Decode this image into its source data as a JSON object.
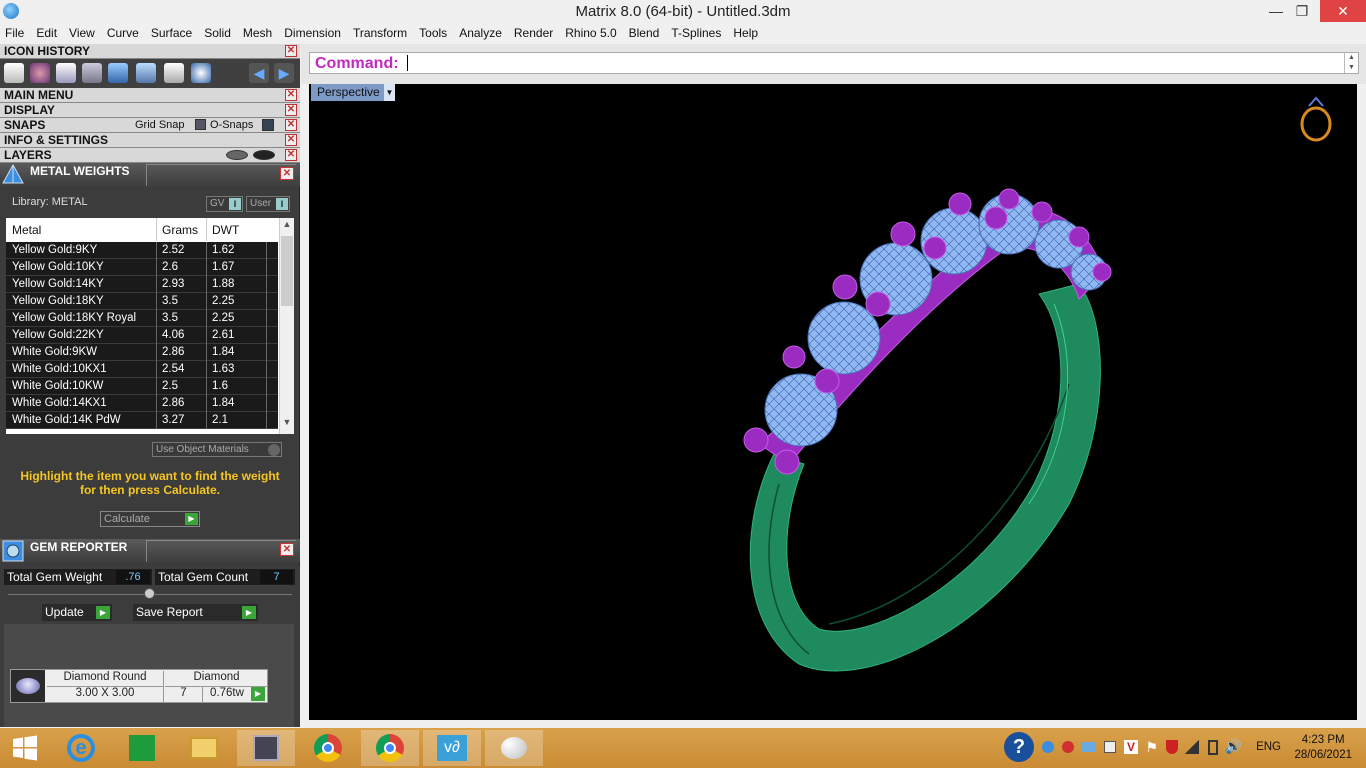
{
  "window": {
    "title": "Matrix 8.0 (64-bit) - Untitled.3dm",
    "min": "—",
    "max": "❐",
    "close": "✕"
  },
  "menu": [
    "File",
    "Edit",
    "View",
    "Curve",
    "Surface",
    "Solid",
    "Mesh",
    "Dimension",
    "Transform",
    "Tools",
    "Analyze",
    "Render",
    "Rhino 5.0",
    "Blend",
    "T-Splines",
    "Help"
  ],
  "panels": {
    "icon_history": "ICON HISTORY",
    "main_menu": "MAIN MENU",
    "display": "DISPLAY",
    "snaps": "SNAPS",
    "grid_snap": "Grid Snap",
    "o_snaps": "O-Snaps",
    "info_settings": "INFO & SETTINGS",
    "layers": "LAYERS"
  },
  "metal_weights": {
    "title": "METAL WEIGHTS",
    "library_label": "Library: METAL",
    "gv_btn": "GV",
    "user_btn": "User",
    "columns": [
      "Metal",
      "Grams",
      "DWT"
    ],
    "rows": [
      {
        "metal": "Yellow Gold:9KY",
        "grams": "2.52",
        "dwt": "1.62"
      },
      {
        "metal": "Yellow Gold:10KY",
        "grams": "2.6",
        "dwt": "1.67"
      },
      {
        "metal": "Yellow Gold:14KY",
        "grams": "2.93",
        "dwt": "1.88"
      },
      {
        "metal": "Yellow Gold:18KY",
        "grams": "3.5",
        "dwt": "2.25"
      },
      {
        "metal": "Yellow Gold:18KY Royal",
        "grams": "3.5",
        "dwt": "2.25"
      },
      {
        "metal": "Yellow Gold:22KY",
        "grams": "4.06",
        "dwt": "2.61"
      },
      {
        "metal": "White Gold:9KW",
        "grams": "2.86",
        "dwt": "1.84"
      },
      {
        "metal": "White Gold:10KX1",
        "grams": "2.54",
        "dwt": "1.63"
      },
      {
        "metal": "White Gold:10KW",
        "grams": "2.5",
        "dwt": "1.6"
      },
      {
        "metal": "White Gold:14KX1",
        "grams": "2.86",
        "dwt": "1.84"
      },
      {
        "metal": "White Gold:14K PdW",
        "grams": "3.27",
        "dwt": "2.1"
      }
    ],
    "use_object_materials": "Use Object Materials",
    "hint": "Highlight the item you want to find the weight for then press Calculate.",
    "calculate": "Calculate"
  },
  "gem_reporter": {
    "title": "GEM REPORTER",
    "total_weight_label": "Total Gem Weight",
    "total_weight_value": ".76",
    "total_count_label": "Total Gem Count",
    "total_count_value": "7",
    "update": "Update",
    "save_report": "Save Report",
    "gem": {
      "shape": "Diamond Round",
      "size": "3.00 X 3.00",
      "material": "Diamond",
      "count": "7",
      "weight": "0.76tw"
    }
  },
  "command": {
    "label": "Command:",
    "value": ""
  },
  "viewport": {
    "name": "Perspective"
  },
  "taskbar": {
    "lang": "ENG",
    "time": "4:23 PM",
    "date": "28/06/2021"
  },
  "colors": {
    "ring_band": "#1f8a5e",
    "prongs": "#9a2cc2",
    "gems": "#8fb8f5",
    "command_label": "#c12ac1",
    "hint": "#f5c623"
  }
}
